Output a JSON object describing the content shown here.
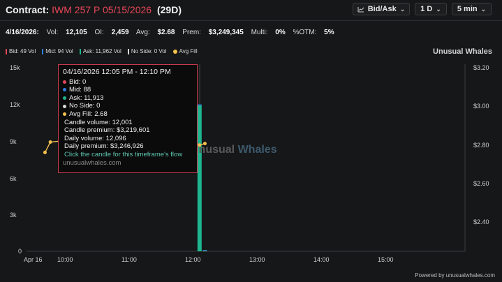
{
  "header": {
    "label": "Contract:",
    "contract": "IWM 257 P 05/15/2026",
    "dte": "(29D)",
    "controls": {
      "mode": "Bid/Ask",
      "interval": "1 D",
      "candle": "5 min"
    }
  },
  "stats": {
    "date": "4/16/2026:",
    "vol_label": "Vol:",
    "vol": "12,105",
    "oi_label": "OI:",
    "oi": "2,459",
    "avg_label": "Avg:",
    "avg": "$2.68",
    "prem_label": "Prem:",
    "prem": "$3,249,345",
    "multi_label": "Multi:",
    "multi": "0%",
    "otm_label": "%OTM:",
    "otm": "5%"
  },
  "legend": {
    "bid": "Bid: 49 Vol",
    "mid": "Mid: 94 Vol",
    "ask": "Ask: 11,962 Vol",
    "noside": "No Side: 0 Vol",
    "fill": "Avg Fill",
    "colors": {
      "bid": "#e5475a",
      "mid": "#2f7fe0",
      "ask": "#1fb58f",
      "noside": "#d9d9d9",
      "fill": "#f4c04e"
    }
  },
  "brand": "Unusual Whales",
  "chart_data": {
    "type": "bar",
    "y_left_ticks": [
      "15k",
      "12k",
      "9k",
      "6k",
      "3k",
      "0"
    ],
    "y_right_ticks": [
      "$3.20",
      "$3.00",
      "$2.80",
      "$2.60",
      "$2.40"
    ],
    "x_ticks": [
      "Apr 16",
      "10:00",
      "11:00",
      "12:00",
      "13:00",
      "14:00",
      "15:00"
    ],
    "ylim_volume": [
      0,
      15000
    ],
    "ylim_price": [
      2.2,
      3.2
    ],
    "volume_bars": [
      {
        "time": "12:05",
        "ask": 11913,
        "bid": 0,
        "mid": 88
      },
      {
        "time": "12:10",
        "ask": 49,
        "bid": 49,
        "mid": 6
      }
    ],
    "avg_fill_points": [
      {
        "time": "09:40",
        "price": 2.63
      },
      {
        "time": "09:45",
        "price": 2.7
      },
      {
        "time": "11:20",
        "price": 2.77
      },
      {
        "time": "11:35",
        "price": 2.81
      },
      {
        "time": "11:50",
        "price": 2.69
      },
      {
        "time": "12:05",
        "price": 2.68
      },
      {
        "time": "12:10",
        "price": 2.69
      }
    ]
  },
  "tooltip": {
    "time": "04/16/2026 12:05 PM - 12:10 PM",
    "bid": "Bid: 0",
    "mid": "Mid: 88",
    "ask": "Ask: 11,913",
    "noside": "No Side: 0",
    "avg_fill": "Avg Fill: 2.68",
    "candle_volume": "Candle volume: 12,001",
    "candle_premium": "Candle premium: $3,219,601",
    "daily_volume": "Daily volume: 12,096",
    "daily_premium": "Daily premium: $3,246,926",
    "link": "Click the candle for this timeframe's flow",
    "site": "unusualwhales.com"
  },
  "watermark": {
    "part1": "Unusual",
    "part2": "Whales"
  },
  "footer": "Powered by unusualwhales.com"
}
